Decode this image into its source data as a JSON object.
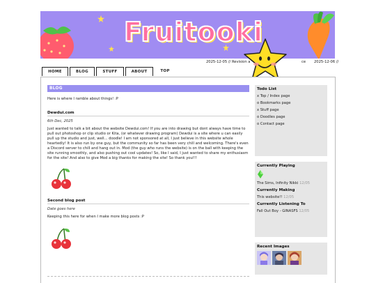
{
  "banner": {
    "logo_text": "Fruitooki",
    "background": "#a08cf2"
  },
  "ticker": {
    "item1": "2025-12-05 // Revision a",
    "item2": "ce",
    "item3": "2025-12-06 //"
  },
  "nav": {
    "tabs": [
      {
        "label": "HOME"
      },
      {
        "label": "BLOG"
      },
      {
        "label": "STUFF"
      },
      {
        "label": "ABOUT"
      },
      {
        "label": "TOP"
      }
    ]
  },
  "main": {
    "section_title": "BLOG",
    "intro": "Here is where I ramble about things! :P",
    "posts": [
      {
        "title": "Dewdui.com",
        "date": "6th Dec, 2025",
        "body": "Just wanted to talk a bit about the website Dewdui.com! If you are into drawing but dont always have time to pull out photoshop or clip studio or Kita, (or whatever drawing program) Dewdui is a site where u can easily pull up the studio and just, well... doodle! I am not sponsored at all, I just believe in this website whole heartedly! It is also run by one guy, but the community so far has been very chill and welcoming. There's even a Discord server to chill and hang out in. Mod (the guy who runs the website) is on the ball with keeping the site running smoothly, and also pushing out cool updates! So, like I said, I just wanted to share my enthusiasm for the site! And also to give Mod a big thanks for making the site! So thank you!!!"
      },
      {
        "title": "Second blog post",
        "date": "Date goes here",
        "body": "Keeping this here for when I make more blog posts :P"
      }
    ]
  },
  "sidebar": {
    "todo": {
      "title": "Todo List",
      "items": [
        "x Top / Index page",
        "o Bookmarks page",
        "x Stuff page",
        "o Doodles page",
        "o Contact page"
      ]
    },
    "playing": {
      "title": "Currently Playing",
      "value": "The Sims, Infinity Nikki",
      "date": "12/05"
    },
    "making": {
      "title": "Currently Making",
      "value": "This website!!",
      "date": "12/05"
    },
    "listening": {
      "title": "Currently Listening To",
      "value": "Fall Out Boy - GINASFS",
      "date": "12/05"
    },
    "recent_images": {
      "title": "Recent Images"
    }
  }
}
